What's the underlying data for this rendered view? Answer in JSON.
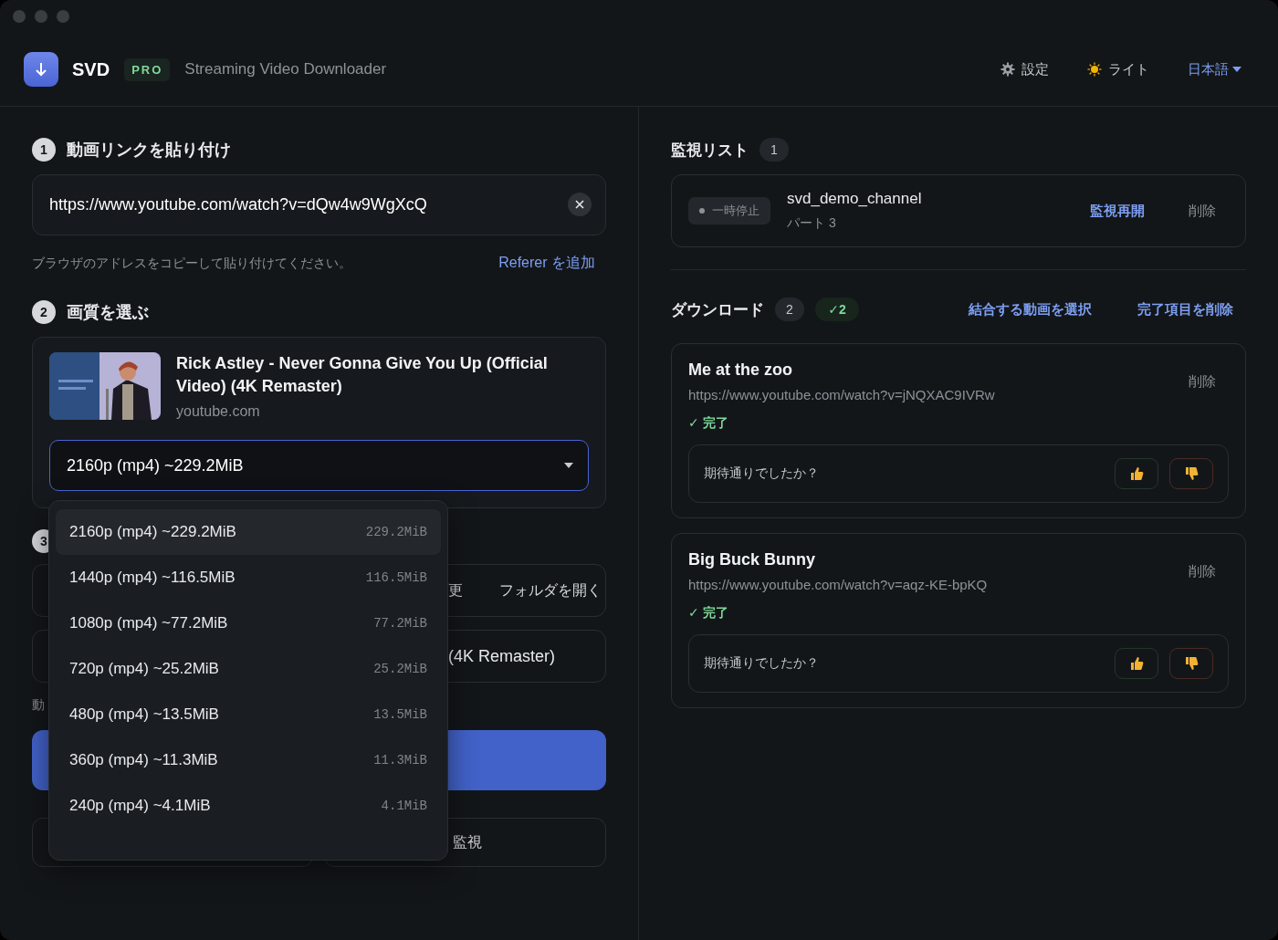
{
  "header": {
    "app_name": "SVD",
    "badge": "PRO",
    "subtitle": "Streaming Video Downloader",
    "actions": [
      {
        "kind": "gear",
        "label": "設定"
      },
      {
        "kind": "sun",
        "label": "ライト"
      }
    ],
    "language": "日本語"
  },
  "link_section": {
    "step": "1",
    "title": "動画リンクを貼り付け",
    "url": "https://www.youtube.com/watch?v=dQw4w9WgXcQ",
    "hint": "ブラウザのアドレスをコピーして貼り付けてください。",
    "referer_link": "Referer を追加"
  },
  "quality_section": {
    "step": "2",
    "title": "画質を選ぶ",
    "video": {
      "kind": "picture",
      "title": "Rick Astley - Never Gonna Give You Up (Official Video) (4K Remaster)",
      "source": "youtube.com"
    },
    "select": {
      "value": "2160p (mp4) ~229.2MiB",
      "expanded": true
    },
    "options": [
      {
        "label": "2160p (mp4) ~229.2MiB",
        "size": "229.2MiB",
        "selected": true
      },
      {
        "label": "1440p (mp4) ~116.5MiB",
        "size": "116.5MiB",
        "selected": false
      },
      {
        "label": "1080p (mp4) ~77.2MiB",
        "size": "77.2MiB",
        "selected": false
      },
      {
        "label": "720p (mp4) ~25.2MiB",
        "size": "25.2MiB",
        "selected": false
      },
      {
        "label": "480p (mp4) ~13.5MiB",
        "size": "13.5MiB",
        "selected": false
      },
      {
        "label": "360p (mp4) ~11.3MiB",
        "size": "11.3MiB",
        "selected": false
      },
      {
        "label": "240p (mp4) ~4.1MiB",
        "size": "4.1MiB",
        "selected": false
      }
    ]
  },
  "output_section": {
    "step": "3",
    "folder_fragment": "更",
    "open_folder": "フォルダを開く",
    "filename_fragment": "(4K Remaster)",
    "hint_fragment": "動",
    "monitor_fragment": "監視"
  },
  "watch_list": {
    "title": "監視リスト",
    "count": "1",
    "items": [
      {
        "status": "一時停止",
        "name": "svd_demo_channel",
        "detail": "パート 3",
        "resume": "監視再開",
        "remove": "削除"
      }
    ]
  },
  "downloads": {
    "title": "ダウンロード",
    "count": "2",
    "done_count": "✓2",
    "merge": "結合する動画を選択",
    "clear": "完了項目を削除",
    "items": [
      {
        "title": "Me at the zoo",
        "url": "https://www.youtube.com/watch?v=jNQXAC9IVRw",
        "remove": "削除",
        "status": "✓ 完了",
        "feedback": "期待通りでしたか？"
      },
      {
        "title": "Big Buck Bunny",
        "url": "https://www.youtube.com/watch?v=aqz-KE-bpKQ",
        "remove": "削除",
        "status": "✓ 完了",
        "feedback": "期待通りでしたか？"
      }
    ]
  }
}
